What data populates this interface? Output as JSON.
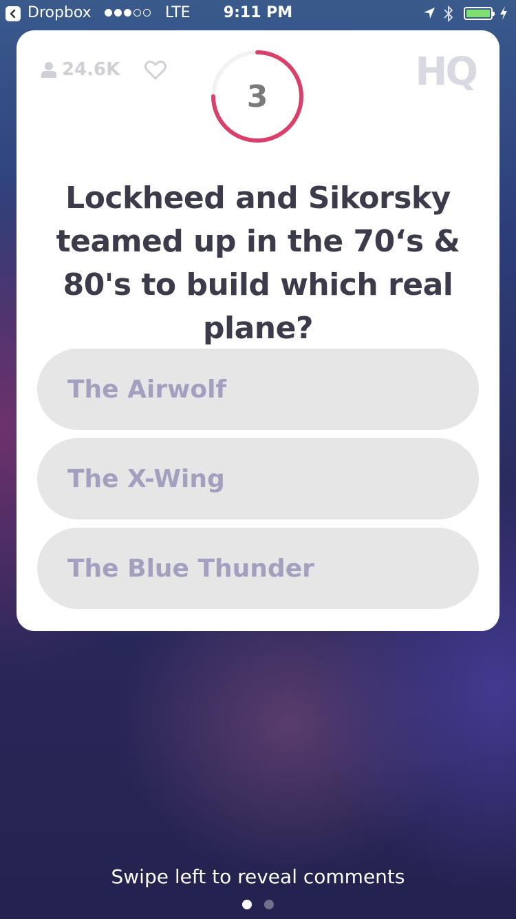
{
  "status_bar": {
    "back_app": "Dropbox",
    "signal_bars": 3,
    "signal_total": 5,
    "carrier": "LTE",
    "time": "9:11 PM",
    "battery_level": 1.0,
    "battery_color": "#7ee06e"
  },
  "header": {
    "viewers": "24.6K",
    "timer_seconds": "3",
    "timer_progress": 0.75,
    "timer_color": "#d9416b",
    "logo": "HQ"
  },
  "question": {
    "text": "Lockheed and Sikorsky teamed up in the 70‘s & 80's to build which real plane?"
  },
  "answers": [
    {
      "label": "The Airwolf"
    },
    {
      "label": "The X-Wing"
    },
    {
      "label": "The Blue Thunder"
    }
  ],
  "footer": {
    "hint": "Swipe left to reveal comments",
    "pages": 2,
    "active_page": 1
  },
  "icons": {
    "back": "back-chevron-icon",
    "location": "location-arrow-icon",
    "bluetooth": "bluetooth-icon",
    "charging": "charging-bolt-icon",
    "viewers": "person-icon",
    "like": "heart-icon"
  }
}
